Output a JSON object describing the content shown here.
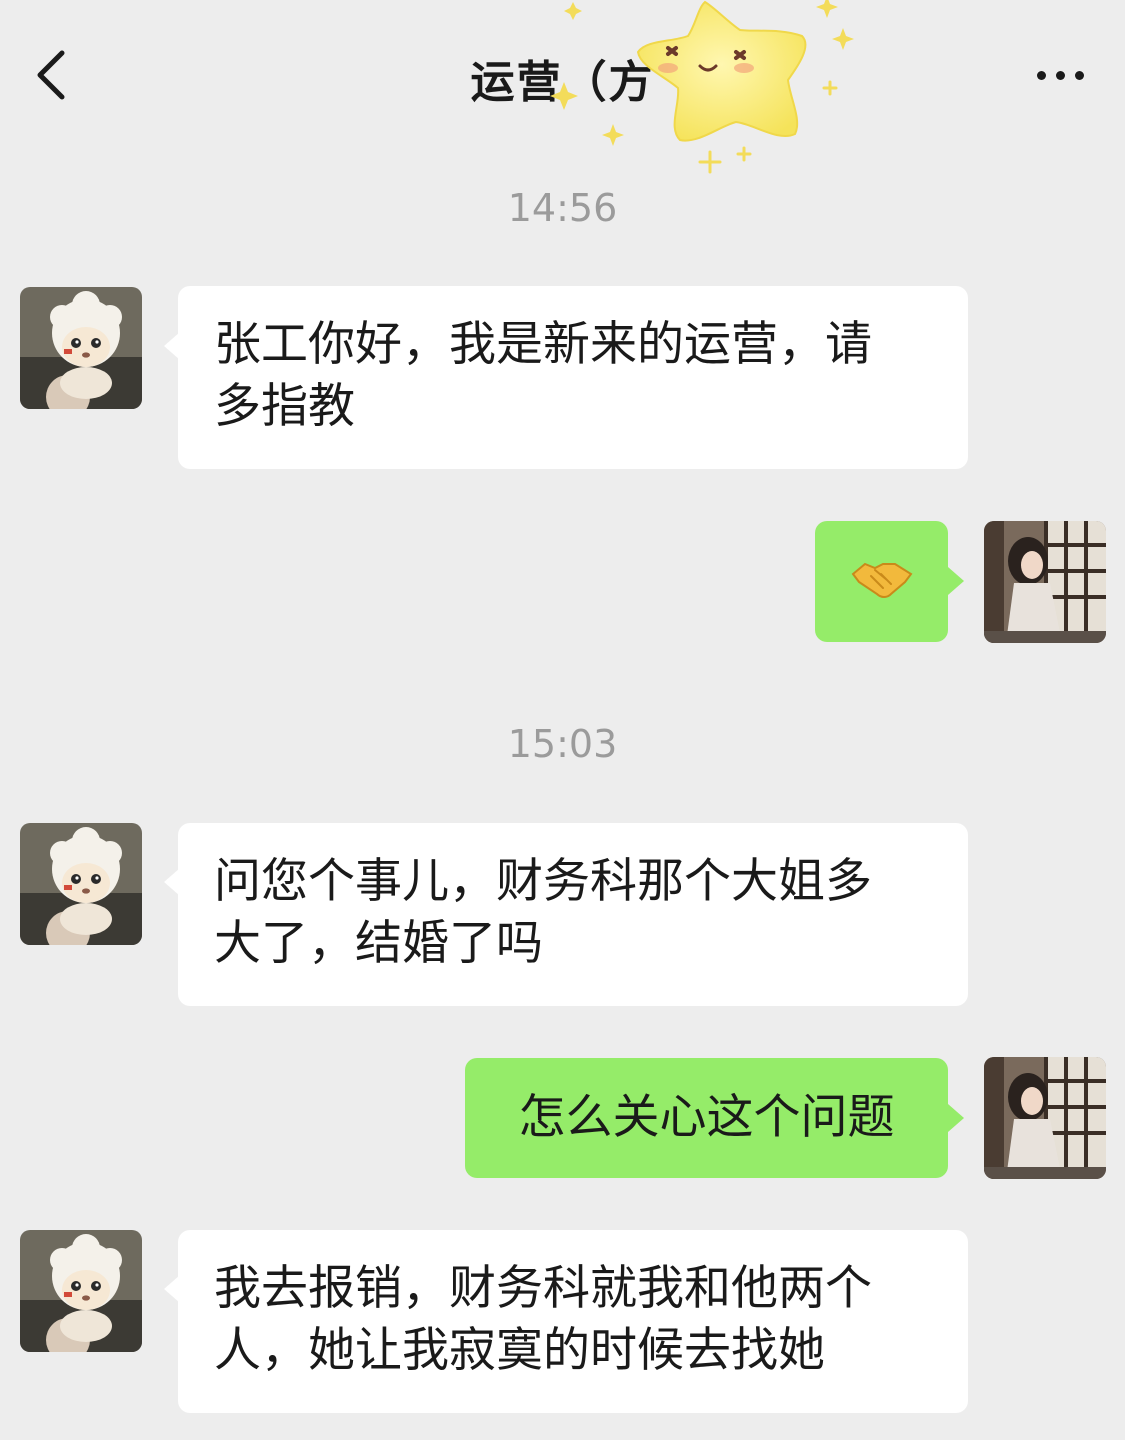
{
  "header": {
    "title": "运营（方",
    "back_icon": "chevron-left-icon",
    "more_icon": "more-dots-icon"
  },
  "sticker": {
    "name": "smiling-star-sticker",
    "color": "#f7e96b"
  },
  "colors": {
    "background": "#ededed",
    "incoming_bubble": "#ffffff",
    "outgoing_bubble": "#95ec69",
    "timestamp": "#9b9b9b"
  },
  "messages": [
    {
      "type": "timestamp",
      "text": "14:56"
    },
    {
      "type": "incoming",
      "sender_avatar": "sheep-cartoon-avatar",
      "text_lines": [
        "张工你好，我是新来的运营，请",
        "多指教"
      ]
    },
    {
      "type": "outgoing",
      "sender_avatar": "girl-photo-avatar",
      "text": "🤝"
    },
    {
      "type": "timestamp",
      "text": "15:03"
    },
    {
      "type": "incoming",
      "sender_avatar": "sheep-cartoon-avatar",
      "text_lines": [
        "问您个事儿，财务科那个大姐多",
        "大了，结婚了吗"
      ]
    },
    {
      "type": "outgoing",
      "sender_avatar": "girl-photo-avatar",
      "text": "怎么关心这个问题"
    },
    {
      "type": "incoming",
      "sender_avatar": "sheep-cartoon-avatar",
      "text_lines": [
        "我去报销，财务科就我和他两个",
        "人，她让我寂寞的时候去找她"
      ]
    }
  ]
}
